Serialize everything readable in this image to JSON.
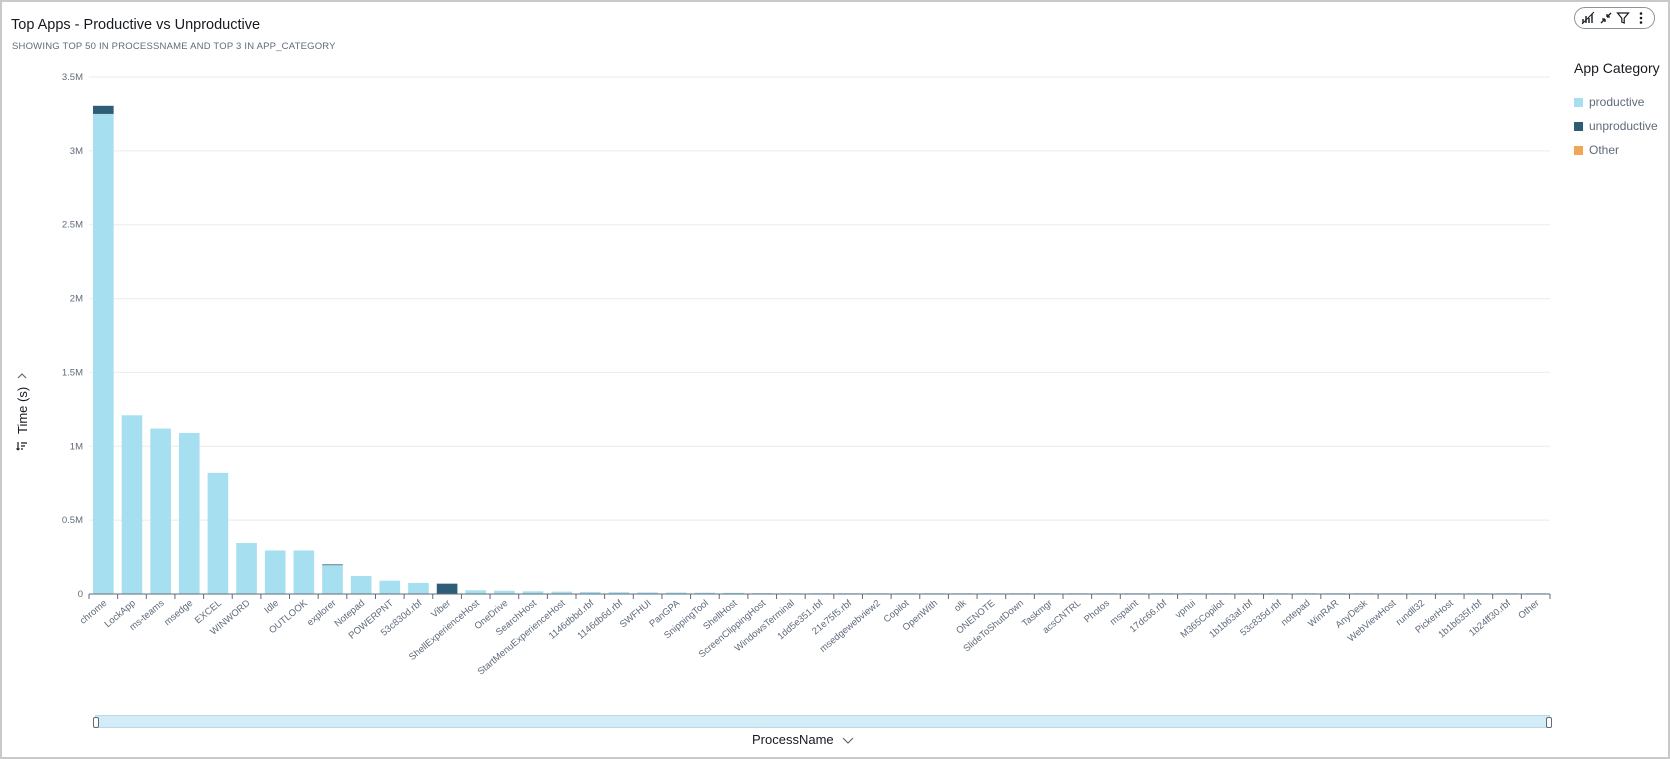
{
  "header": {
    "title": "Top Apps - Productive vs Unproductive",
    "subtitle": "SHOWING TOP 50 IN PROCESSNAME AND TOP 3 IN APP_CATEGORY"
  },
  "toolbar": {
    "icons": [
      "chart-type-icon",
      "collapse-icon",
      "filter-icon",
      "more-options-icon"
    ]
  },
  "legend": {
    "title": "App Category",
    "items": [
      {
        "label": "productive",
        "color": "#a6dff0"
      },
      {
        "label": "unproductive",
        "color": "#2f5c76"
      },
      {
        "label": "Other",
        "color": "#f2a654"
      }
    ]
  },
  "axes": {
    "ylabel": "Time (s)",
    "xlabel": "ProcessName"
  },
  "chart_data": {
    "type": "bar",
    "stacked": true,
    "title": "Top Apps - Productive vs Unproductive",
    "xlabel": "ProcessName",
    "ylabel": "Time (s)",
    "ylim": [
      0,
      3500000
    ],
    "yticks": [
      {
        "value": 0,
        "label": "0"
      },
      {
        "value": 500000,
        "label": "0.5M"
      },
      {
        "value": 1000000,
        "label": "1M"
      },
      {
        "value": 1500000,
        "label": "1.5M"
      },
      {
        "value": 2000000,
        "label": "2M"
      },
      {
        "value": 2500000,
        "label": "2.5M"
      },
      {
        "value": 3000000,
        "label": "3M"
      },
      {
        "value": 3500000,
        "label": "3.5M"
      }
    ],
    "grid": true,
    "legend_position": "right",
    "categories": [
      "chrome",
      "LockApp",
      "ms-teams",
      "msedge",
      "EXCEL",
      "WINWORD",
      "Idle",
      "OUTLOOK",
      "explorer",
      "Notepad",
      "POWERPNT",
      "53c830d.rbf",
      "Viber",
      "ShellExperienceHost",
      "OneDrive",
      "SearchHost",
      "StartMenuExperienceHost",
      "1146dbbd.rbf",
      "1146db6d.rbf",
      "SWFHUI",
      "PanGPA",
      "SnippingTool",
      "ShellHost",
      "ScreenClippingHost",
      "WindowsTerminal",
      "1dd5e351.rbf",
      "21e75f5.rbf",
      "msedgewebview2",
      "Copilot",
      "OpenWith",
      "olk",
      "ONENOTE",
      "SlideToShutDown",
      "Taskmgr",
      "acsCNTRL",
      "Photos",
      "mspaint",
      "17dc66.rbf",
      "vpnui",
      "M365Copilot",
      "1b1b63af.rbf",
      "53c835d.rbf",
      "notepad",
      "WinRAR",
      "AnyDesk",
      "WebViewHost",
      "rundll32",
      "PickerHost",
      "1b1b635f.rbf",
      "1b24ff30.rbf",
      "Other"
    ],
    "series": [
      {
        "name": "productive",
        "color": "#a6dff0",
        "values": [
          3250000,
          1210000,
          1120000,
          1090000,
          820000,
          345000,
          295000,
          295000,
          195000,
          122000,
          90000,
          75000,
          0,
          25000,
          22000,
          18000,
          16000,
          14000,
          12000,
          11000,
          10000,
          9000,
          8000,
          6000,
          5000,
          3000,
          2500,
          2000,
          1800,
          1500,
          1200,
          1000,
          900,
          800,
          700,
          600,
          500,
          450,
          400,
          350,
          300,
          250,
          200,
          180,
          160,
          140,
          120,
          100,
          80,
          60,
          50
        ]
      },
      {
        "name": "unproductive",
        "color": "#2f5c76",
        "values": [
          55000,
          0,
          0,
          0,
          0,
          0,
          0,
          0,
          5000,
          0,
          0,
          0,
          70000,
          0,
          0,
          0,
          0,
          0,
          0,
          0,
          0,
          0,
          0,
          0,
          0,
          0,
          0,
          0,
          0,
          0,
          0,
          0,
          0,
          0,
          0,
          0,
          0,
          0,
          0,
          0,
          0,
          0,
          0,
          0,
          0,
          0,
          0,
          0,
          0,
          0,
          0
        ]
      },
      {
        "name": "Other",
        "color": "#f2a654",
        "values": [
          0,
          0,
          0,
          0,
          0,
          0,
          0,
          0,
          0,
          0,
          0,
          0,
          0,
          0,
          0,
          0,
          0,
          0,
          0,
          0,
          0,
          0,
          0,
          0,
          0,
          0,
          0,
          0,
          0,
          0,
          0,
          0,
          0,
          0,
          0,
          0,
          0,
          0,
          0,
          0,
          0,
          0,
          0,
          0,
          0,
          0,
          0,
          0,
          0,
          0,
          0
        ]
      }
    ]
  }
}
